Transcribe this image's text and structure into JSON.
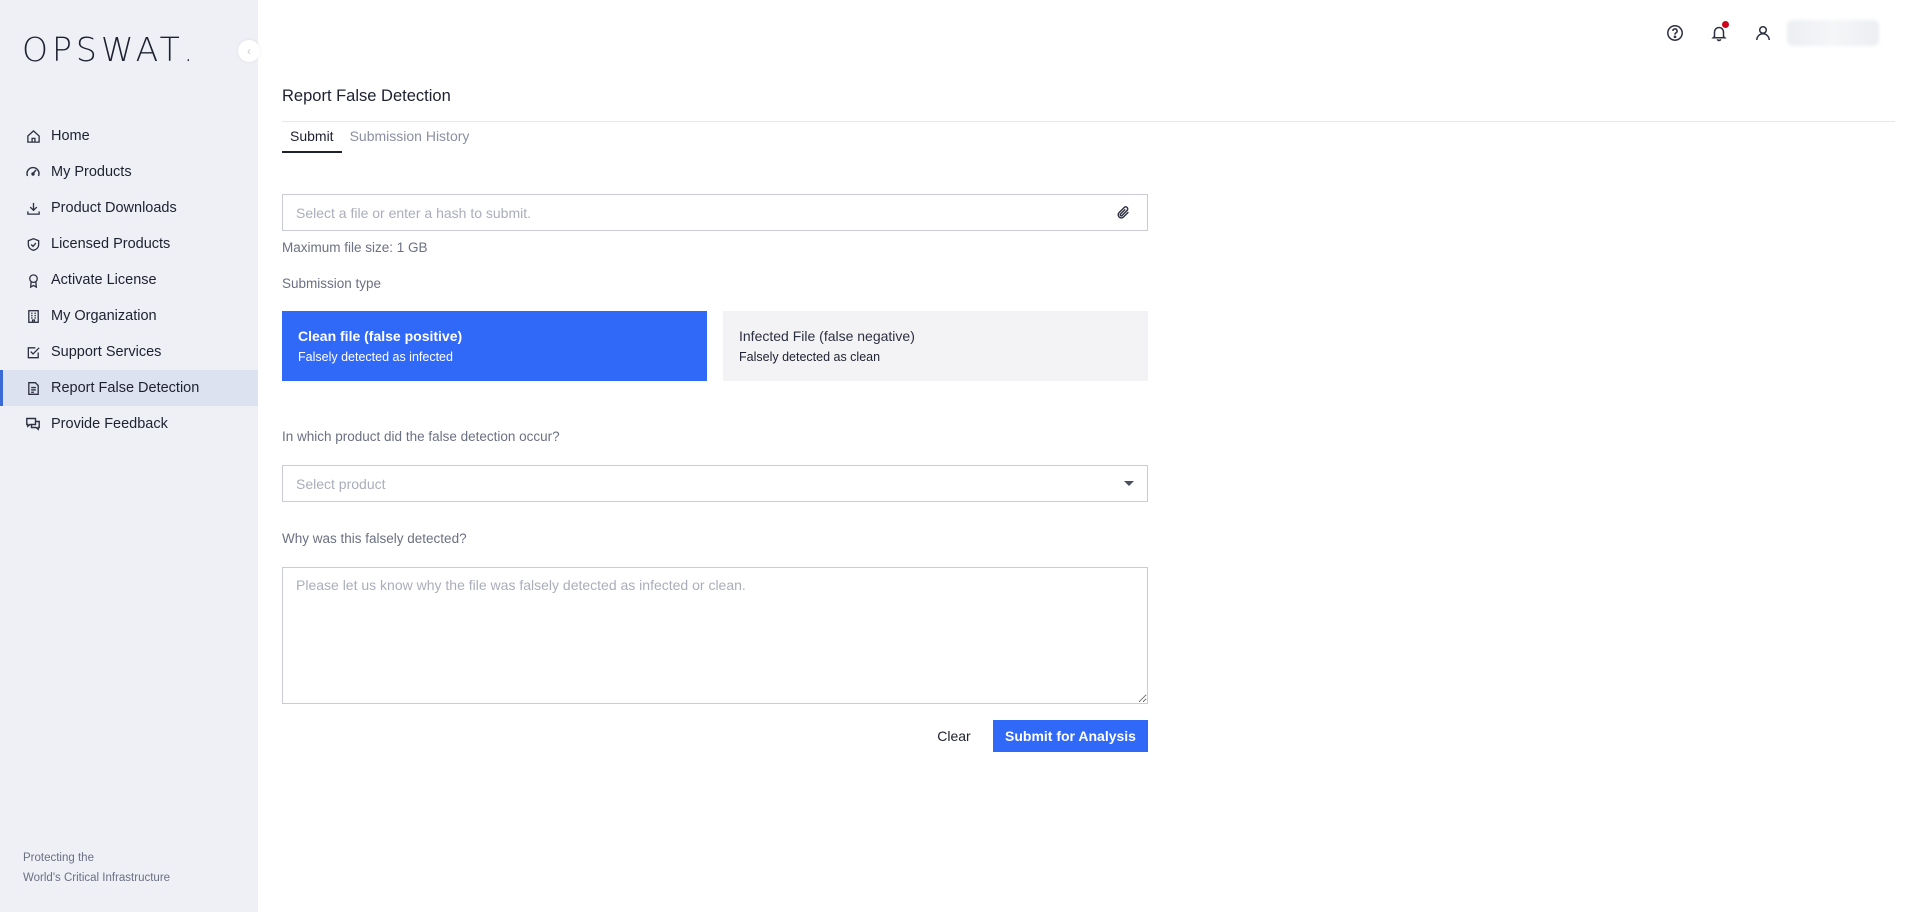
{
  "brand": {
    "logo_text": "OPSWAT",
    "logo_dot": "."
  },
  "sidebar": {
    "collapse_icon": "‹",
    "items": [
      {
        "label": "Home",
        "icon": "home-icon"
      },
      {
        "label": "My Products",
        "icon": "gauge-icon"
      },
      {
        "label": "Product Downloads",
        "icon": "download-icon"
      },
      {
        "label": "Licensed Products",
        "icon": "shield-check-icon"
      },
      {
        "label": "Activate License",
        "icon": "award-icon"
      },
      {
        "label": "My Organization",
        "icon": "building-icon"
      },
      {
        "label": "Support Services",
        "icon": "checkbox-icon"
      },
      {
        "label": "Report False Detection",
        "icon": "document-icon",
        "active": true
      },
      {
        "label": "Provide Feedback",
        "icon": "chat-icon"
      }
    ],
    "footer": {
      "line1": "Protecting the",
      "line2": "World's Critical Infrastructure"
    }
  },
  "header": {
    "icons": [
      "help-icon",
      "bell-icon",
      "user-icon"
    ],
    "notification_color": "#d0021b"
  },
  "page": {
    "title": "Report False Detection",
    "tabs": [
      {
        "label": "Submit",
        "active": true
      },
      {
        "label": "Submission History",
        "active": false
      }
    ],
    "file_input": {
      "placeholder": "Select a file or enter a hash to submit.",
      "value": ""
    },
    "max_file_size": "Maximum file size: 1 GB",
    "submission_type_label": "Submission type",
    "submission_types": [
      {
        "title": "Clean file (false positive)",
        "subtitle": "Falsely detected as infected",
        "selected": true
      },
      {
        "title": "Infected File (false negative)",
        "subtitle": "Falsely detected as clean",
        "selected": false
      }
    ],
    "product_question": "In which product did the false detection occur?",
    "product_select": {
      "placeholder": "Select product"
    },
    "reason_question": "Why was this falsely detected?",
    "reason_textarea": {
      "placeholder": "Please let us know why the file was falsely detected as infected or clean.",
      "value": ""
    },
    "buttons": {
      "clear": "Clear",
      "submit": "Submit for Analysis"
    }
  },
  "colors": {
    "accent": "#3068f7",
    "sidebar_bg": "#eef0f6",
    "active_item_bg": "#dde2f0"
  }
}
